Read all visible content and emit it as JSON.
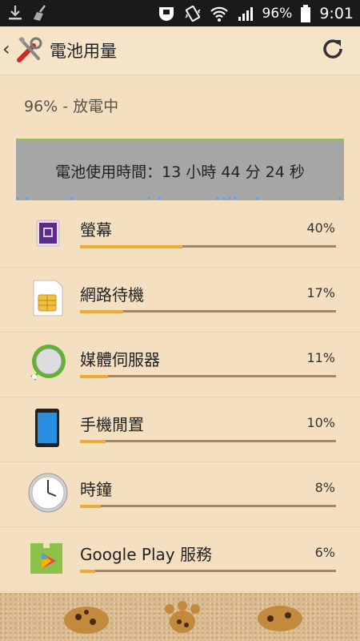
{
  "status_bar": {
    "battery_percent": "96%",
    "time": "9:01",
    "icons": [
      "download-icon",
      "broom-icon",
      "sony-icon",
      "vibrate-icon",
      "wifi-icon",
      "signal-icon",
      "battery-icon"
    ]
  },
  "action_bar": {
    "title": "電池用量",
    "icons": [
      "back-chevron-icon",
      "tools-icon",
      "refresh-icon"
    ]
  },
  "battery": {
    "status": "96% - 放電中",
    "usage_time": "電池使用時間：13 小時 44 分 24 秒"
  },
  "items": [
    {
      "label": "螢幕",
      "percent": "40%",
      "value": 0.4,
      "icon": "screen-icon"
    },
    {
      "label": "網路待機",
      "percent": "17%",
      "value": 0.17,
      "icon": "sim-card-icon"
    },
    {
      "label": "媒體伺服器",
      "percent": "11%",
      "value": 0.11,
      "icon": "media-server-icon"
    },
    {
      "label": "手機閒置",
      "percent": "10%",
      "value": 0.1,
      "icon": "phone-icon"
    },
    {
      "label": "時鐘",
      "percent": "8%",
      "value": 0.08,
      "icon": "clock-icon"
    },
    {
      "label": "Google Play 服務",
      "percent": "6%",
      "value": 0.06,
      "icon": "puzzle-icon"
    }
  ],
  "colors": {
    "background": "#f4dfc1",
    "bar_fill": "#f0aa3a",
    "bar_track": "#a08767",
    "graph_bg": "#a6a6a6",
    "graph_line": "#7ecb52"
  }
}
